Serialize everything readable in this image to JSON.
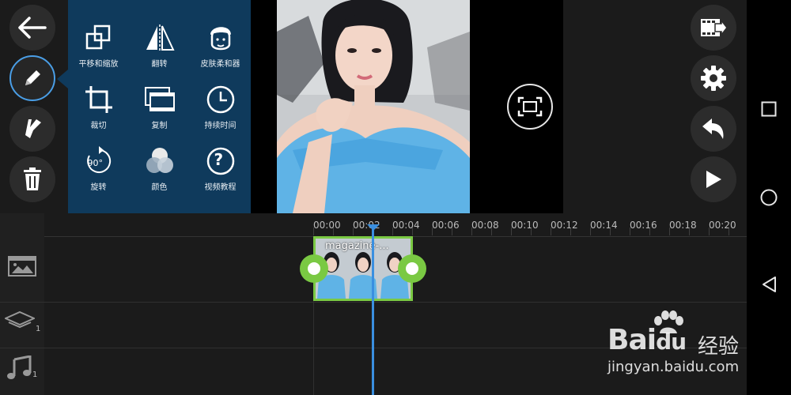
{
  "edit_tools": [
    {
      "label": "平移和缩放",
      "icon": "pan-zoom-icon"
    },
    {
      "label": "翻转",
      "icon": "flip-icon"
    },
    {
      "label": "皮肤柔和器",
      "icon": "skin-smoother-icon"
    },
    {
      "label": "裁切",
      "icon": "crop-icon"
    },
    {
      "label": "复制",
      "icon": "duplicate-icon"
    },
    {
      "label": "持续时间",
      "icon": "duration-icon"
    },
    {
      "label": "旋转",
      "icon": "rotate-icon"
    },
    {
      "label": "颜色",
      "icon": "color-icon"
    },
    {
      "label": "视频教程",
      "icon": "help-icon"
    }
  ],
  "rotate_badge": "90°",
  "help_glyph": "?",
  "timeline": {
    "ticks": [
      "00:00",
      "00:02",
      "00:04",
      "00:06",
      "00:08",
      "00:10",
      "00:12",
      "00:14",
      "00:16",
      "00:18",
      "00:20"
    ],
    "clip_title": "magazine-...",
    "layer_count": "1",
    "audio_count": "1"
  },
  "watermark": {
    "brand_latin": "Bai",
    "brand_du": "du",
    "brand_cn": "经验",
    "url": "jingyan.baidu.com"
  },
  "colors": {
    "panel": "#0f3a5c",
    "accent": "#4a9ee6",
    "clip_border": "#7ac943",
    "playhead": "#3a8fe0"
  }
}
